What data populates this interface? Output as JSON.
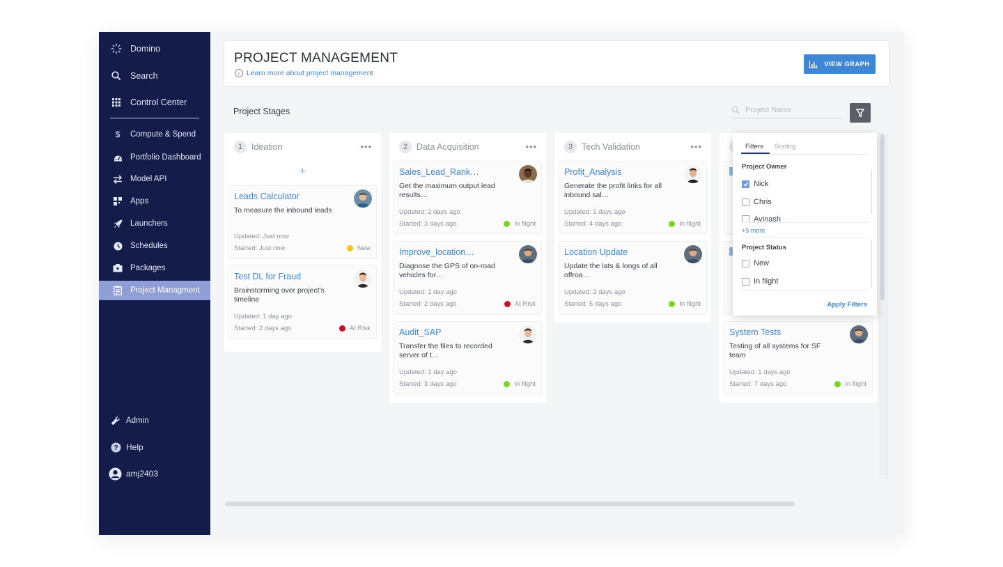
{
  "sidebar": {
    "brand": "Domino",
    "search": "Search",
    "control_center": "Control Center",
    "items": [
      {
        "label": "Compute & Spend",
        "icon": "dollar-icon"
      },
      {
        "label": "Portfolio Dashboard",
        "icon": "dashboard-icon"
      },
      {
        "label": "Model API",
        "icon": "swap-arrows-icon"
      },
      {
        "label": "Apps",
        "icon": "apps-icon"
      },
      {
        "label": "Launchers",
        "icon": "rocket-icon"
      },
      {
        "label": "Schedules",
        "icon": "clock-icon"
      },
      {
        "label": "Packages",
        "icon": "package-icon"
      },
      {
        "label": "Project Managment",
        "icon": "clipboard-icon",
        "active": true
      }
    ],
    "admin": "Admin",
    "help": "Help",
    "user": "amj2403"
  },
  "header": {
    "title": "PROJECT MANAGEMENT",
    "learn_more": "Learn more about project management",
    "view_graph": "VIEW GRAPH"
  },
  "stages": {
    "title": "Project Stages",
    "search_placeholder": "Project Name"
  },
  "columns": [
    {
      "number": "1",
      "name": "Ideation",
      "cards": [
        {
          "title": "Leads Calculator",
          "desc": "To measure the inbound leads",
          "updated": "Updated: Just now",
          "started": "Started: Just now",
          "status": "New"
        },
        {
          "title": "Test DL for Fraud",
          "desc": "Brainstorming over project's timeline",
          "updated": "Updated: 1 day ago",
          "started": "Started: 2 days ago",
          "status": "At Risk"
        }
      ]
    },
    {
      "number": "2",
      "name": "Data Acquisition",
      "cards": [
        {
          "title": "Sales_Lead_Rank…",
          "desc": "Get the maximum output lead results…",
          "updated": "Updated: 2 days ago",
          "started": "Started: 3 days ago",
          "status": "In flight"
        },
        {
          "title": "Improve_location…",
          "desc": "Diagnose the GPS of on-road vehicles for…",
          "updated": "Updated: 1 day ago",
          "started": "Started: 2 days ago",
          "status": "At Risk"
        },
        {
          "title": "Audit_SAP",
          "desc": "Transfer the files to recorded server of t…",
          "updated": "Updated: 1 day ago",
          "started": "Started: 3 days ago",
          "status": "In flight"
        }
      ]
    },
    {
      "number": "3",
      "name": "Tech Validation",
      "cards": [
        {
          "title": "Profit_Analysis",
          "desc": "Generate the profit links for all inbound sal…",
          "updated": "Updated: 1 days ago",
          "started": "Started: 4 days ago",
          "status": "In flight"
        },
        {
          "title": "Location Update",
          "desc": "Update the lats & longs of all offroa…",
          "updated": "Updated: 2 days ago",
          "started": "Started: 5 days ago",
          "status": "In flight"
        }
      ]
    },
    {
      "cards": [
        {
          "title": "System Tests",
          "desc": "Testing of all systems for SF team",
          "updated": "Updated: 1 days ago",
          "started": "Started: 7 days ago",
          "status": "In flight"
        }
      ]
    }
  ],
  "status_colors": {
    "New": "#f5c518",
    "At Risk": "#c8102e",
    "In flight": "#7ed321"
  },
  "filters": {
    "tab_filters": "Filters",
    "tab_sorting": "Sorting",
    "owner_title": "Project Owner",
    "owners": [
      "Nick",
      "Chris",
      "Avinash"
    ],
    "owner_checked": [
      "Nick"
    ],
    "more": "+5 more",
    "status_title": "Project Status",
    "statuses": [
      "New",
      "In flight"
    ],
    "apply": "Apply Filters"
  },
  "colors": {
    "sidebar": "#141c4a",
    "accent": "#3f86d6",
    "active_nav": "#8f9ed6"
  }
}
